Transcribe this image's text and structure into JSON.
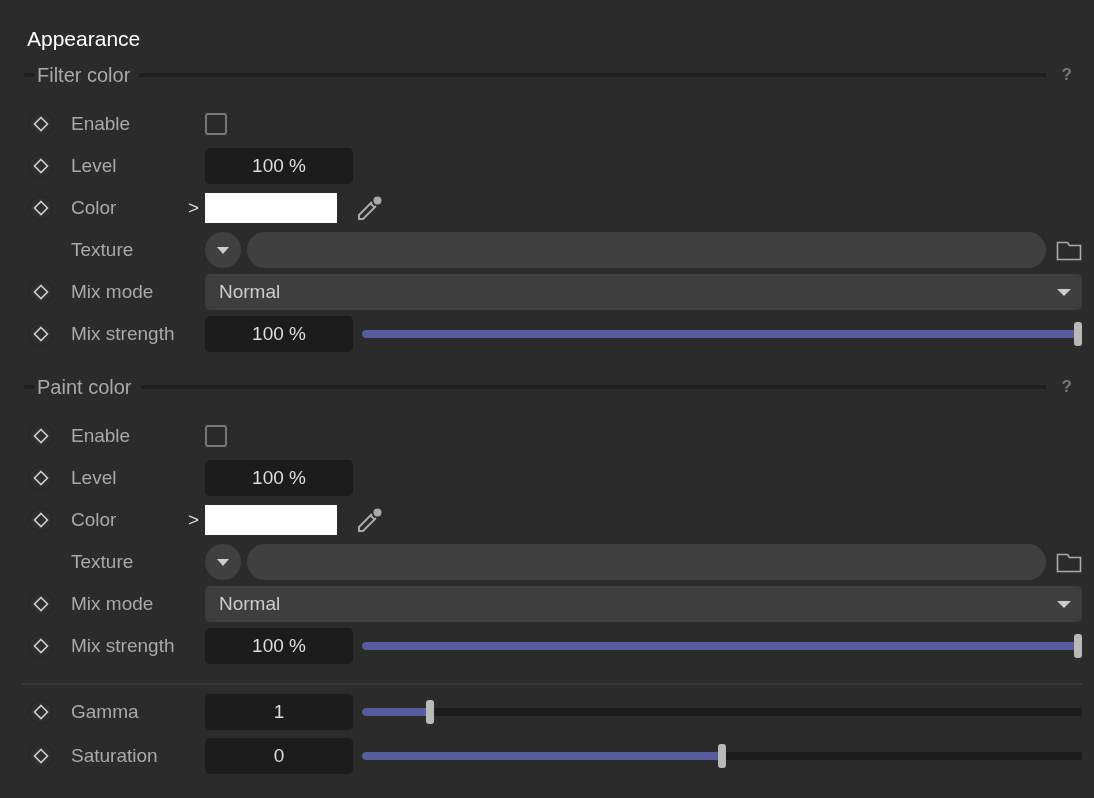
{
  "title": "Appearance",
  "groups": [
    {
      "title": "Filter color",
      "help": "?",
      "rows": [
        {
          "kind": "checkbox",
          "keyframe": true,
          "label": "Enable",
          "checked": false
        },
        {
          "kind": "number",
          "keyframe": true,
          "label": "Level",
          "value": "100 %"
        },
        {
          "kind": "color",
          "keyframe": true,
          "label": "Color",
          "expand": ">",
          "color": "#ffffff"
        },
        {
          "kind": "texture",
          "keyframe": false,
          "label": "Texture"
        },
        {
          "kind": "dropdown",
          "keyframe": true,
          "label": "Mix mode",
          "value": "Normal"
        },
        {
          "kind": "slider",
          "keyframe": true,
          "label": "Mix strength",
          "value": "100 %",
          "level": 1
        }
      ]
    },
    {
      "title": "Paint color",
      "help": "?",
      "rows": [
        {
          "kind": "checkbox",
          "keyframe": true,
          "label": "Enable",
          "checked": false
        },
        {
          "kind": "number",
          "keyframe": true,
          "label": "Level",
          "value": "100 %"
        },
        {
          "kind": "color",
          "keyframe": true,
          "label": "Color",
          "expand": ">",
          "color": "#ffffff"
        },
        {
          "kind": "texture",
          "keyframe": false,
          "label": "Texture"
        },
        {
          "kind": "dropdown",
          "keyframe": true,
          "label": "Mix mode",
          "value": "Normal"
        },
        {
          "kind": "slider",
          "keyframe": true,
          "label": "Mix strength",
          "value": "100 %",
          "level": 1
        }
      ]
    }
  ],
  "rows": [
    {
      "kind": "slider",
      "keyframe": true,
      "label": "Gamma",
      "value": "1",
      "level": 0.09
    },
    {
      "kind": "slider",
      "keyframe": true,
      "label": "Saturation",
      "value": "0",
      "level": 0.5
    }
  ]
}
